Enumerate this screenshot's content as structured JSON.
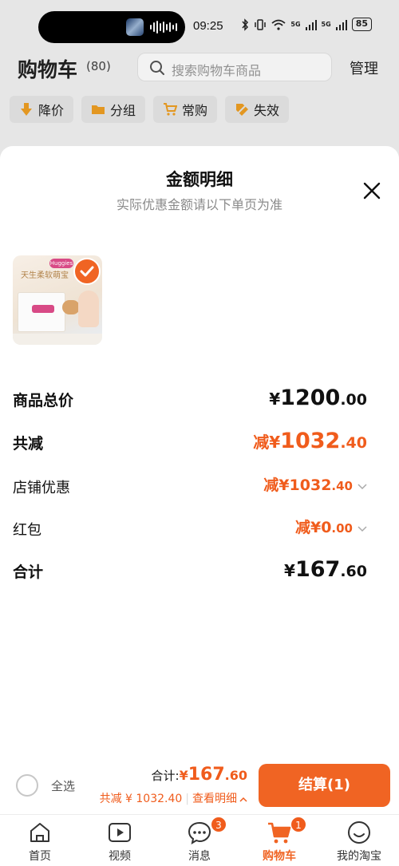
{
  "status_bar": {
    "time": "09:25",
    "network_1": "5G",
    "network_2": "5G",
    "battery": "85"
  },
  "header": {
    "title": "购物车",
    "count": "(80)",
    "search_placeholder": "搜索购物车商品",
    "manage": "管理"
  },
  "filters": [
    {
      "label": "降价",
      "icon": "price-down-icon"
    },
    {
      "label": "分组",
      "icon": "folder-icon"
    },
    {
      "label": "常购",
      "icon": "cart-icon"
    },
    {
      "label": "失效",
      "icon": "invalid-tag-icon"
    }
  ],
  "sheet": {
    "title": "金额明细",
    "subtitle": "实际优惠金额请以下单页为准",
    "product": {
      "brand": "Huggies",
      "script": "天生柔软萌宝"
    },
    "rows": [
      {
        "label": "商品总价",
        "prefix": "",
        "symbol": "¥",
        "int": "1200",
        "dec": ".00"
      },
      {
        "label": "共减",
        "prefix": "减",
        "symbol": "¥",
        "int": "1032",
        "dec": ".40"
      },
      {
        "label": "店铺优惠",
        "prefix": "减",
        "symbol": "¥",
        "int": "1032",
        "dec": ".40"
      },
      {
        "label": "红包",
        "prefix": "减",
        "symbol": "¥",
        "int": "0",
        "dec": ".00"
      },
      {
        "label": "合计",
        "prefix": "",
        "symbol": "¥",
        "int": "167",
        "dec": ".60"
      }
    ]
  },
  "bottom": {
    "select_all": "全选",
    "total_label": "合计:",
    "total_symbol": "¥",
    "total_int": "167",
    "total_dec": ".60",
    "saved": "共减 ¥ 1032.40",
    "view_detail": "查看明细",
    "checkout": "结算(1)"
  },
  "tabs": [
    {
      "label": "首页",
      "icon": "home-icon",
      "badge": ""
    },
    {
      "label": "视频",
      "icon": "video-icon",
      "badge": ""
    },
    {
      "label": "消息",
      "icon": "message-icon",
      "badge": "3"
    },
    {
      "label": "购物车",
      "icon": "cart-icon",
      "badge": "1"
    },
    {
      "label": "我的淘宝",
      "icon": "profile-icon",
      "badge": ""
    }
  ],
  "colors": {
    "accent": "#f06423",
    "discount": "#f05c1c"
  }
}
